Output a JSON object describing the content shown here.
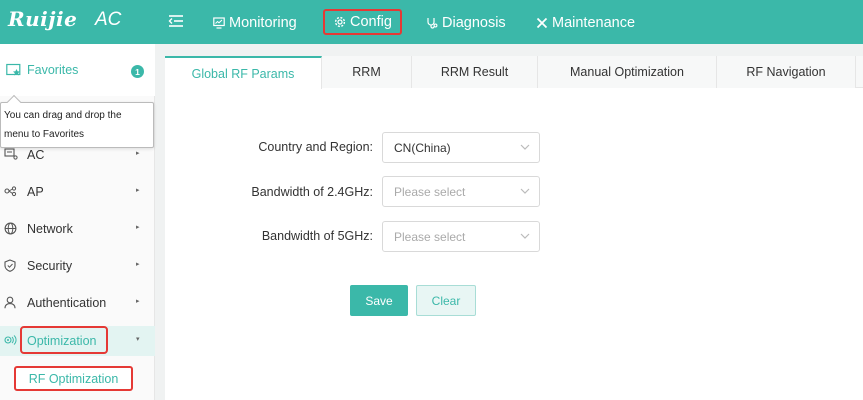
{
  "header": {
    "logo_text": "Ruijie",
    "product": "AC",
    "nav": {
      "monitoring": "Monitoring",
      "config": "Config",
      "diagnosis": "Diagnosis",
      "maintenance": "Maintenance"
    }
  },
  "sidebar": {
    "favorites": {
      "label": "Favorites",
      "badge": "1"
    },
    "tooltip": {
      "line1": "You can drag and drop the",
      "line2": "menu to Favorites"
    },
    "items": [
      {
        "label": "AC",
        "icon": "ac-icon"
      },
      {
        "label": "AP",
        "icon": "ap-icon"
      },
      {
        "label": "Network",
        "icon": "network-icon"
      },
      {
        "label": "Security",
        "icon": "shield-icon"
      },
      {
        "label": "Authentication",
        "icon": "user-icon"
      },
      {
        "label": "Optimization",
        "icon": "optimization-icon"
      }
    ],
    "sub_item": "RF Optimization"
  },
  "tabs": [
    "Global RF Params",
    "RRM",
    "RRM Result",
    "Manual Optimization",
    "RF Navigation"
  ],
  "form": {
    "country_label": "Country and Region:",
    "country_value": "CN(China)",
    "bw24_label": "Bandwidth of 2.4GHz:",
    "bw24_placeholder": "Please select",
    "bw5_label": "Bandwidth of 5GHz:",
    "bw5_placeholder": "Please select"
  },
  "buttons": {
    "save": "Save",
    "clear": "Clear"
  },
  "colors": {
    "brand": "#3bb8a9",
    "highlight": "#e53935"
  }
}
